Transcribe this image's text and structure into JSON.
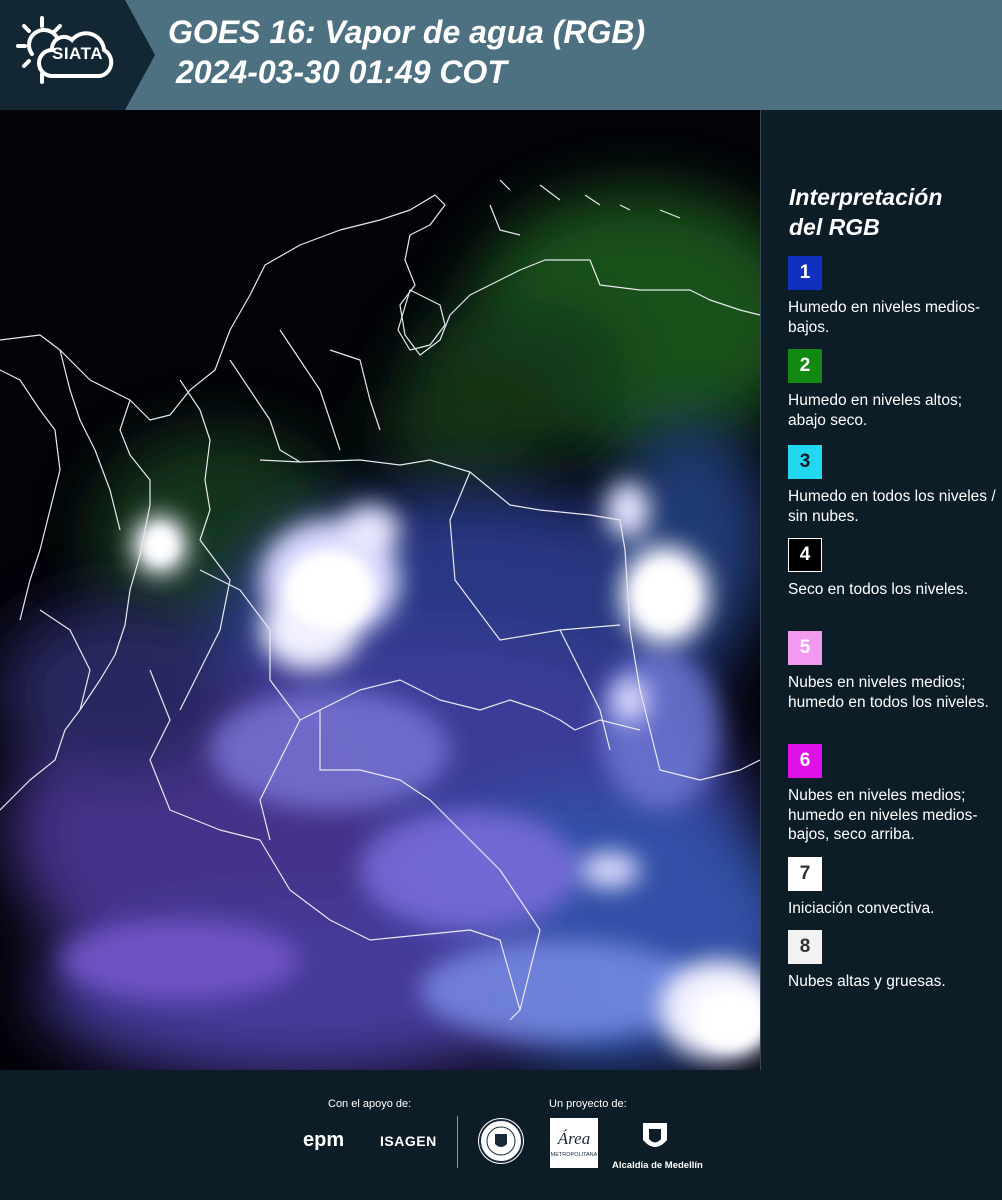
{
  "header": {
    "logo_text": "SIATA",
    "title_line1": "GOES 16: Vapor de agua (RGB)",
    "title_line2": "2024-03-30 01:49 COT"
  },
  "legend": {
    "title_line1": "Interpretación",
    "title_line2": "del RGB",
    "items": [
      {
        "number": "1",
        "color": "#1030c0",
        "text_color": "#ffffff",
        "label": "Humedo en niveles medios-bajos."
      },
      {
        "number": "2",
        "color": "#128a12",
        "text_color": "#ffffff",
        "label": "Humedo en niveles altos; abajo seco."
      },
      {
        "number": "3",
        "color": "#22d8f0",
        "text_color": "#0d1d27",
        "label": "Humedo en todos los niveles / sin nubes."
      },
      {
        "number": "4",
        "color": "#000000",
        "text_color": "#ffffff",
        "label": "Seco en todos los niveles."
      },
      {
        "number": "5",
        "color": "#f29af0",
        "text_color": "#ffffff",
        "label": "Nubes en niveles medios; humedo en todos los niveles."
      },
      {
        "number": "6",
        "color": "#e010e8",
        "text_color": "#ffffff",
        "label": "Nubes en niveles medios; humedo en niveles medios-bajos, seco arriba."
      },
      {
        "number": "7",
        "color": "#ffffff",
        "text_color": "#333333",
        "label": "Iniciación convectiva."
      },
      {
        "number": "8",
        "color": "#f2f2f2",
        "text_color": "#333333",
        "label": "Nubes altas y gruesas."
      }
    ]
  },
  "footer": {
    "support_label": "Con el apoyo de:",
    "project_label": "Un proyecto de:",
    "epm": "epm",
    "isagen": "ISAGEN",
    "area_text": "Área",
    "area_sub": "METROPOLITANA",
    "medellin": "Alcaldía de Medellín"
  }
}
